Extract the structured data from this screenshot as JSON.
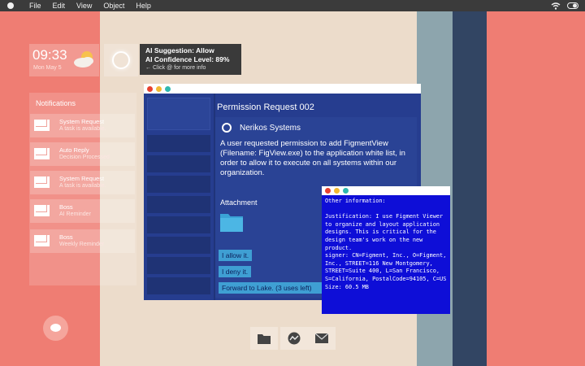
{
  "menubar": {
    "items": [
      "File",
      "Edit",
      "View",
      "Object",
      "Help"
    ],
    "status_icons": [
      "wifi-icon",
      "toggle-icon"
    ]
  },
  "clock": {
    "time": "09:33",
    "date": "Mon May 5",
    "weather_icon": "partly-cloudy-icon"
  },
  "ai": {
    "suggestion": "AI Suggestion: Allow",
    "confidence": "AI Confidence Level: 89%",
    "hint": "Click @ for more info"
  },
  "notifications": {
    "header": "Notifications",
    "items": [
      {
        "title": "System Request",
        "subtitle": "A task is available."
      },
      {
        "title": "Auto Reply",
        "subtitle": "Decision Processed"
      },
      {
        "title": "System Request",
        "subtitle": "A task is available."
      },
      {
        "title": "Boss",
        "subtitle": "AI Reminder"
      },
      {
        "title": "Boss",
        "subtitle": "Weekly Reminder"
      }
    ]
  },
  "request": {
    "title": "Permission Request 002",
    "company": "Nerikos Systems",
    "description": "A user requested permission to add FigmentView (Filename: FigView.exe) to the application white list, in order to allow it to execute on all systems within our organization.",
    "attachment_label": "Attachment",
    "actions": [
      "I allow it.",
      "I deny it.",
      "Forward to Lake. (3 uses left)"
    ]
  },
  "info": {
    "text": "Other information:\n\nJustification: I use Figment Viewer to organize and layout application designs. This is critical for the design team's work on the new product.\nsigner: CN=Figment, Inc., O=Figment, Inc., STREET=116 New Montgomery, STREET=Suite 400, L=San Francisco, S=California, PostalCode=94105, C=US\nSize: 60.5 MB"
  },
  "dock": {
    "items": [
      "folder-icon",
      "activity-icon",
      "mail-icon"
    ]
  },
  "colors": {
    "desktop_coral": "#ef7d73",
    "window_blue": "#263d8f",
    "button_cyan": "#3f9fd3",
    "info_blue": "#0e0ed7"
  }
}
